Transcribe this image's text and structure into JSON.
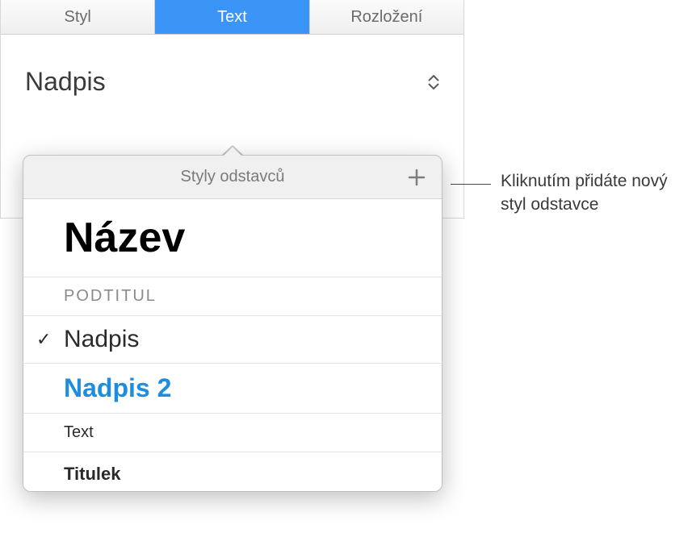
{
  "tabs": {
    "style": "Styl",
    "text": "Text",
    "layout": "Rozložení"
  },
  "selector": {
    "current": "Nadpis"
  },
  "popover": {
    "title": "Styly odstavců",
    "items": {
      "nazev": "Název",
      "podtitul": "PODTITUL",
      "nadpis": "Nadpis",
      "nadpis2": "Nadpis 2",
      "text": "Text",
      "titulek": "Titulek"
    }
  },
  "callout": {
    "text": "Kliknutím přidáte nový styl odstavce"
  }
}
